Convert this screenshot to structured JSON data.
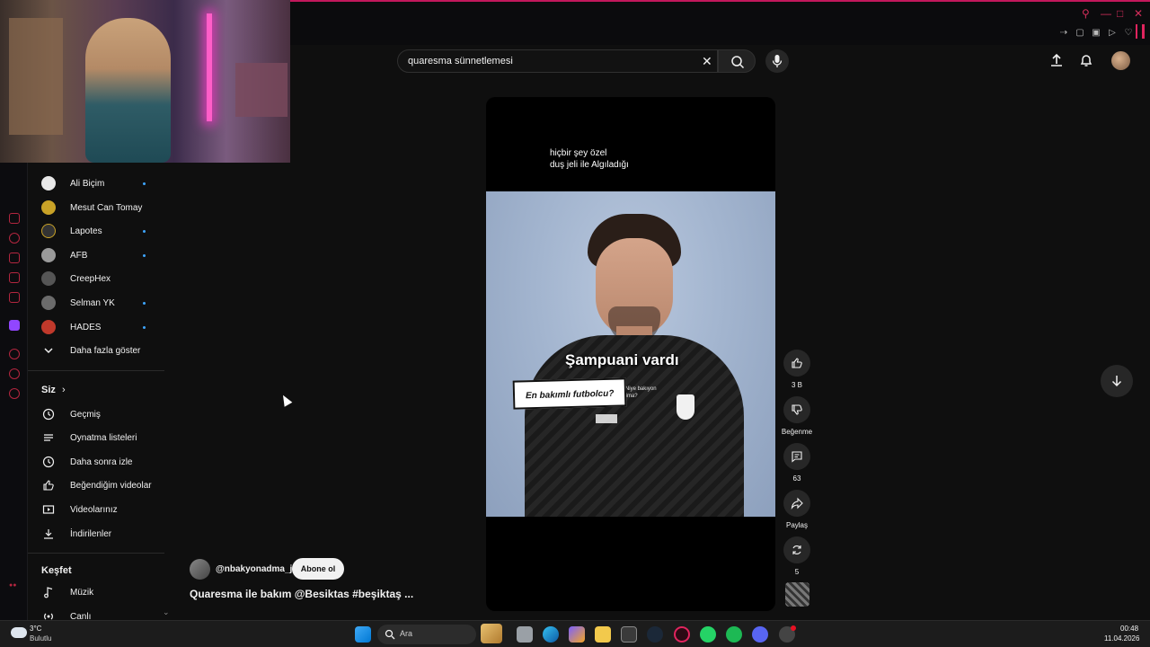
{
  "search": {
    "value": "quaresma sünnetlemesi"
  },
  "sidebar": {
    "subscriptions": [
      {
        "label": "Ali Biçim",
        "dot": true,
        "color": "#e8e8e8"
      },
      {
        "label": "Mesut Can Tomay",
        "dot": false,
        "color": "#c9a227"
      },
      {
        "label": "Lapotes",
        "dot": true,
        "color": "#333333"
      },
      {
        "label": "AFB",
        "dot": true,
        "color": "#9a9a9a"
      },
      {
        "label": "CreepHex",
        "dot": false,
        "color": "#555555"
      },
      {
        "label": "Selman YK",
        "dot": true,
        "color": "#6b6b6b"
      },
      {
        "label": "HADES",
        "dot": true,
        "color": "#c0392b"
      }
    ],
    "show_more": "Daha fazla göster",
    "you_heading": "Siz",
    "you_items": [
      {
        "label": "Geçmiş",
        "icon": "history-icon"
      },
      {
        "label": "Oynatma listeleri",
        "icon": "playlist-icon"
      },
      {
        "label": "Daha sonra izle",
        "icon": "clock-icon"
      },
      {
        "label": "Beğendiğim videolar",
        "icon": "thumb-up-icon"
      },
      {
        "label": "Videolarınız",
        "icon": "video-icon"
      },
      {
        "label": "İndirilenler",
        "icon": "download-icon"
      }
    ],
    "explore_heading": "Keşfet",
    "explore_items": [
      {
        "label": "Müzik",
        "icon": "music-icon"
      },
      {
        "label": "Canlı",
        "icon": "live-icon"
      }
    ]
  },
  "video": {
    "caption_line1": "hiçbir şey özel",
    "caption_line2": "duş jeli ile Algıladığı",
    "overlay_text": "Şampuani vardı",
    "overlay_box": "En bakımlı futbolcu?",
    "watermark_line1": "YouTube: Niye bakıyon",
    "watermark_line2": "adima?"
  },
  "actions": {
    "likes": "3 B",
    "dislike_label": "Beğenme",
    "comments": "63",
    "share_label": "Paylaş",
    "remix": "5"
  },
  "channel": {
    "name": "@nbakyonadma_jk",
    "subscribe_label": "Abone ol",
    "title": "Quaresma ile bakım @Besiktas #beşiktaş ..."
  },
  "taskbar": {
    "weather_temp": "3°C",
    "weather_desc": "Bulutlu",
    "search_label": "Ara",
    "time": "00:48",
    "date": "11.04.2026"
  },
  "colors": {
    "accent": "#e0245e",
    "link_dot": "#3ea6ff"
  }
}
